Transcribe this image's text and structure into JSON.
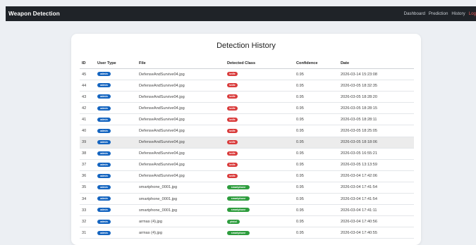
{
  "navbar": {
    "brand": "Weapon Detection",
    "links": [
      "Dashboard",
      "Prediction",
      "History",
      "Log"
    ]
  },
  "page": {
    "title": "Detection History"
  },
  "table": {
    "headers": [
      "ID",
      "User Type",
      "File",
      "Detected Class",
      "Confidence",
      "Date"
    ],
    "rows": [
      {
        "id": "45",
        "user_type": "admin",
        "file": "DefenseAndSurvive04.jpg",
        "class": "knife",
        "confidence": "0.95",
        "date": "2026-03-14 15:23:08"
      },
      {
        "id": "44",
        "user_type": "admin",
        "file": "DefenseAndSurvive04.jpg",
        "class": "knife",
        "confidence": "0.95",
        "date": "2026-03-05 18:32:35"
      },
      {
        "id": "43",
        "user_type": "admin",
        "file": "DefenseAndSurvive04.jpg",
        "class": "knife",
        "confidence": "0.95",
        "date": "2026-03-05 18:28:20"
      },
      {
        "id": "42",
        "user_type": "admin",
        "file": "DefenseAndSurvive04.jpg",
        "class": "knife",
        "confidence": "0.95",
        "date": "2026-03-05 18:28:15"
      },
      {
        "id": "41",
        "user_type": "admin",
        "file": "DefenseAndSurvive04.jpg",
        "class": "knife",
        "confidence": "0.95",
        "date": "2026-03-05 18:28:11"
      },
      {
        "id": "40",
        "user_type": "admin",
        "file": "DefenseAndSurvive04.jpg",
        "class": "knife",
        "confidence": "0.95",
        "date": "2026-03-05 18:25:05"
      },
      {
        "id": "39",
        "user_type": "admin",
        "file": "DefenseAndSurvive04.jpg",
        "class": "knife",
        "confidence": "0.95",
        "date": "2026-03-05 18:18:06"
      },
      {
        "id": "38",
        "user_type": "admin",
        "file": "DefenseAndSurvive04.jpg",
        "class": "knife",
        "confidence": "0.95",
        "date": "2026-03-05 16:55:21"
      },
      {
        "id": "37",
        "user_type": "admin",
        "file": "DefenseAndSurvive04.jpg",
        "class": "knife",
        "confidence": "0.95",
        "date": "2026-03-05 13:13:59"
      },
      {
        "id": "36",
        "user_type": "admin",
        "file": "DefenseAndSurvive04.jpg",
        "class": "knife",
        "confidence": "0.95",
        "date": "2026-03-04 17:42:06"
      },
      {
        "id": "35",
        "user_type": "admin",
        "file": "smartphone_0001.jpg",
        "class": "smartphone",
        "confidence": "0.95",
        "date": "2026-03-04 17:41:54"
      },
      {
        "id": "34",
        "user_type": "admin",
        "file": "smartphone_0001.jpg",
        "class": "smartphone",
        "confidence": "0.95",
        "date": "2026-03-04 17:41:54"
      },
      {
        "id": "33",
        "user_type": "admin",
        "file": "smartphone_0001.jpg",
        "class": "smartphone",
        "confidence": "0.95",
        "date": "2026-03-04 17:41:11"
      },
      {
        "id": "32",
        "user_type": "admin",
        "file": "armas (4).jpg",
        "class": "pistol",
        "confidence": "0.95",
        "date": "2026-03-04 17:40:56"
      },
      {
        "id": "31",
        "user_type": "admin",
        "file": "armas (4).jpg",
        "class": "smartphone",
        "confidence": "0.95",
        "date": "2026-03-04 17:40:55"
      }
    ],
    "highlighted_row_id": "39"
  },
  "colors": {
    "navbar_bg": "#1f2328",
    "admin_badge": "#1565c0",
    "knife_badge": "#d93b3b",
    "smartphone_badge": "#2e9d3e",
    "pistol_badge": "#2e9d3e",
    "logout_link": "#e45a5a"
  }
}
